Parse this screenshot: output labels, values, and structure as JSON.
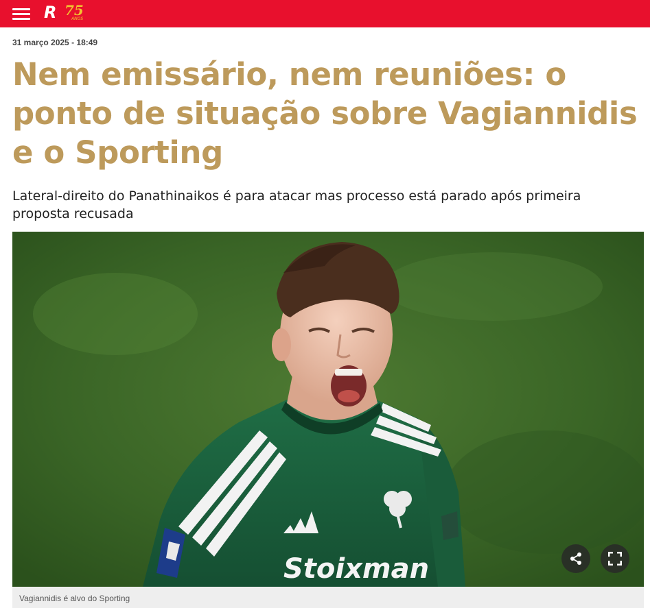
{
  "header": {
    "background_color": "#e8102d",
    "menu_icon": "hamburger-menu-icon",
    "logo_letter": "R",
    "logo_number": "75",
    "logo_sub": "ANOS"
  },
  "article": {
    "date": "31 março 2025 - 18:49",
    "headline": "Nem emissário, nem reuniões: o ponto de situação sobre Vagiannidis e o Sporting",
    "headline_color": "#bd9a5b",
    "subtitle": "Lateral-direito do Panathinaikos é para atacar mas processo está parado após primeira proposta recusada",
    "photo": {
      "shirt_text": "Stoixman",
      "share_icon": "share-icon",
      "fullscreen_icon": "fullscreen-icon"
    },
    "caption": "Vagiannidis é alvo do Sporting"
  }
}
